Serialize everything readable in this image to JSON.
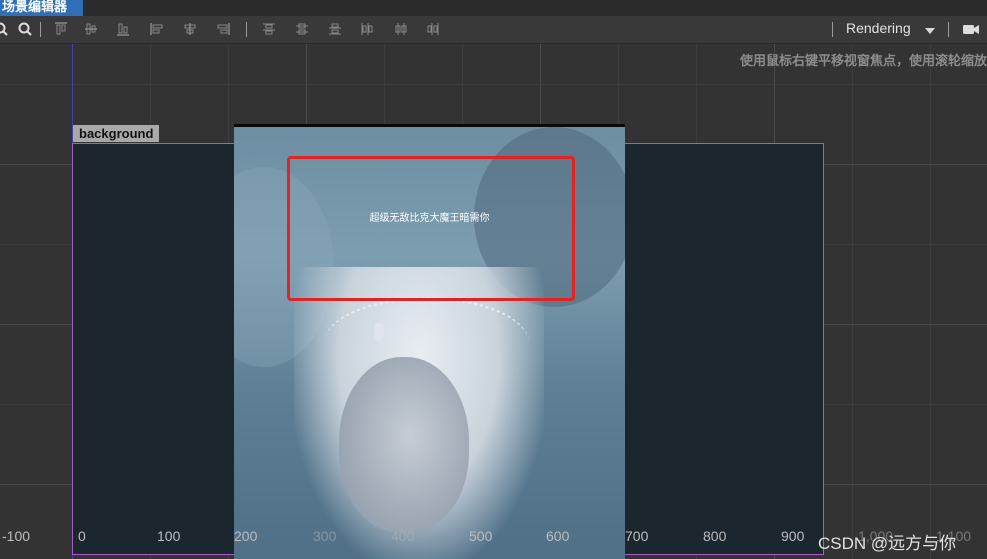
{
  "tab": {
    "title": "场景编辑器"
  },
  "toolbar": {
    "rendering_label": "Rendering",
    "icons": [
      "zoom-out-icon",
      "zoom-in-icon",
      "align-top-icon",
      "align-vcenter-icon",
      "align-bottom-icon",
      "align-left-icon",
      "align-hcenter-icon",
      "align-right-icon",
      "distribute-top-icon",
      "distribute-vcenter-icon",
      "distribute-bottom-icon",
      "distribute-left-icon",
      "distribute-hcenter-icon",
      "distribute-right-icon",
      "camera-icon"
    ]
  },
  "scene": {
    "hint": "使用鼠标右键平移视窗焦点，使用滚轮缩放",
    "background_label": "background",
    "node_text": "超级无敌比克大魔王暗需你",
    "ruler_labels": [
      "-100",
      "0",
      "100",
      "200",
      "300",
      "400",
      "500",
      "600",
      "700",
      "800",
      "900",
      "1,000",
      "1,100"
    ]
  },
  "watermark": "CSDN @远方与你",
  "colors": {
    "tab_active": "#2f6fb7",
    "selection_outline": "#a35fc6",
    "highlight_box": "#e02424",
    "axis_line": "#3b46a8"
  }
}
